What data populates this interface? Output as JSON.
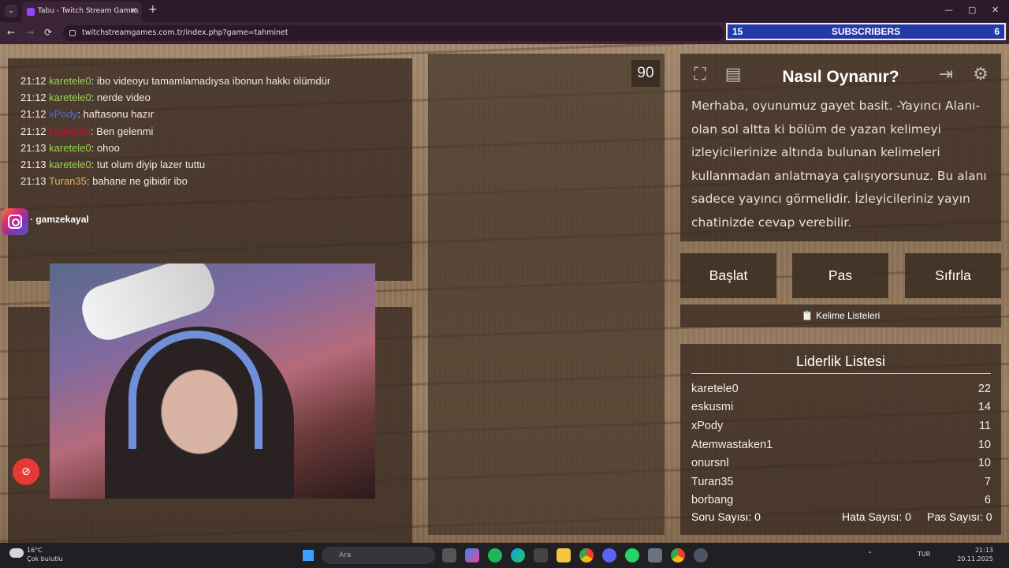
{
  "browser": {
    "tab_title": "Tabu - Twitch Stream Games",
    "tab_close": "✕",
    "new_tab": "+",
    "url": "twitchstreamgames.com.tr/index.php?game=tahminet",
    "win_min": "—",
    "win_max": "▢",
    "win_close": "✕",
    "back": "←",
    "forward": "→",
    "reload": "⟳"
  },
  "subs_bar": {
    "left": "15",
    "label": "SUBSCRIBERS",
    "right": "6"
  },
  "chat": [
    {
      "time": "21:12",
      "user": "karetele0",
      "color": "#9ad35a",
      "msg": ": ibo videoyu tamamlamadıysa ibonun hakkı ölümdür"
    },
    {
      "time": "21:12",
      "user": "karetele0",
      "color": "#9ad35a",
      "msg": ": nerde video"
    },
    {
      "time": "21:12",
      "user": "xPody",
      "color": "#4a6fd8",
      "msg": ": haftasonu hazır"
    },
    {
      "time": "21:12",
      "user": "kaankdm",
      "color": "#c8102e",
      "msg": ": Ben gelenmi"
    },
    {
      "time": "21:13",
      "user": "karetele0",
      "color": "#9ad35a",
      "msg": ": ohoo"
    },
    {
      "time": "21:13",
      "user": "karetele0",
      "color": "#9ad35a",
      "msg": ": tut olum diyip lazer tuttu"
    },
    {
      "time": "21:13",
      "user": "Turan35",
      "color": "#e0b060",
      "msg": ": bahane ne gibidir ibo"
    }
  ],
  "instagram_handle": "· gamzekayal",
  "timer": "90",
  "howto": {
    "title": "Nasıl Oynanır?",
    "text": "Merhaba, oyunumuz gayet basit. -Yayıncı Alanı- olan sol altta ki bölüm de yazan kelimeyi izleyicilerinize altında bulunan kelimeleri kullanmadan anlatmaya çalışıyorsunuz. Bu alanı sadece yayıncı görmelidir. İzleyicileriniz yayın chatinizde cevap verebilir."
  },
  "buttons": {
    "start": "Başlat",
    "pass": "Pas",
    "reset": "Sıfırla"
  },
  "word_lists": "📋 Kelime Listeleri",
  "leaderboard": {
    "title": "Liderlik Listesi",
    "rows": [
      {
        "name": "karetele0",
        "score": "22"
      },
      {
        "name": "eskusmi",
        "score": "14"
      },
      {
        "name": "xPody",
        "score": "11"
      },
      {
        "name": "Atemwastaken1",
        "score": "10"
      },
      {
        "name": "onursnl",
        "score": "10"
      },
      {
        "name": "Turan35",
        "score": "7"
      },
      {
        "name": "borbang",
        "score": "6"
      }
    ]
  },
  "stats": {
    "questions": "Soru Sayısı: 0",
    "errors": "Hata Sayısı: 0",
    "passes": "Pas Sayısı: 0"
  },
  "taskbar": {
    "temp": "16°C",
    "weather": "Çok bulutlu",
    "search": "Ara",
    "lang": "TUR",
    "time": "21:13",
    "date": "20.11.2025"
  }
}
